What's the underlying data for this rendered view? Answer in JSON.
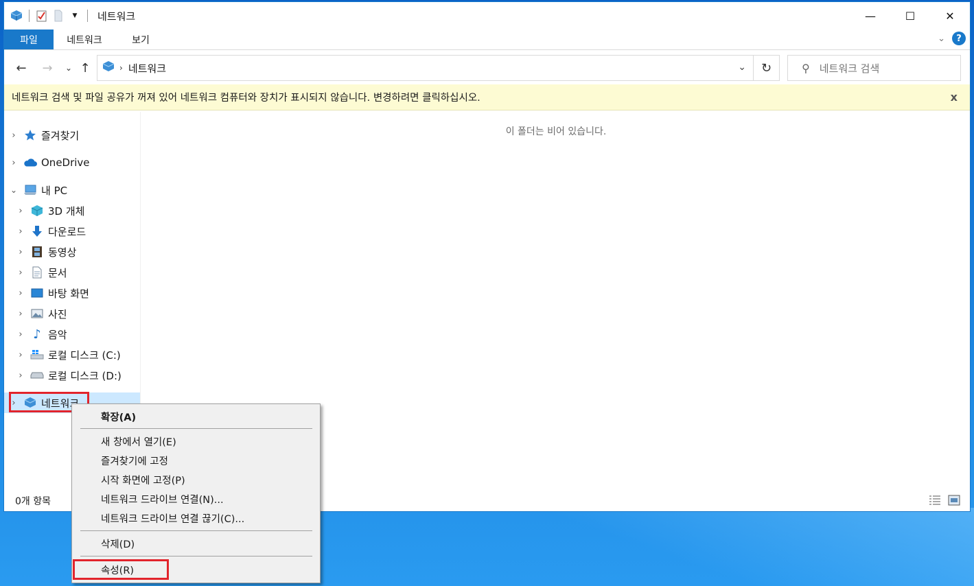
{
  "window": {
    "title": "네트워크",
    "controls": {
      "minimize": "—",
      "maximize": "☐",
      "close": "✕"
    }
  },
  "ribbon": {
    "tabs": [
      "파일",
      "네트워크",
      "보기"
    ],
    "help": "?"
  },
  "address": {
    "breadcrumb": "네트워크",
    "search_placeholder": "네트워크 검색"
  },
  "infobar": {
    "message": "네트워크 검색 및 파일 공유가 꺼져 있어 네트워크 컴퓨터와 장치가 표시되지 않습니다. 변경하려면 클릭하십시오.",
    "close": "x"
  },
  "navpane": {
    "items": [
      {
        "label": "즐겨찾기",
        "icon": "star-icon"
      },
      {
        "label": "OneDrive",
        "icon": "cloud-icon"
      },
      {
        "label": "내 PC",
        "icon": "computer-icon"
      },
      {
        "label": "3D 개체",
        "icon": "cube-icon"
      },
      {
        "label": "다운로드",
        "icon": "download-arrow-icon"
      },
      {
        "label": "동영상",
        "icon": "film-icon"
      },
      {
        "label": "문서",
        "icon": "document-icon"
      },
      {
        "label": "바탕 화면",
        "icon": "desktop-icon"
      },
      {
        "label": "사진",
        "icon": "picture-icon"
      },
      {
        "label": "음악",
        "icon": "music-note-icon"
      },
      {
        "label": "로컬 디스크 (C:)",
        "icon": "windows-drive-icon"
      },
      {
        "label": "로컬 디스크 (D:)",
        "icon": "drive-icon"
      },
      {
        "label": "네트워크",
        "icon": "network-icon"
      }
    ]
  },
  "content": {
    "empty_message": "이 폴더는 비어 있습니다."
  },
  "status": {
    "item_count": "0개 항목"
  },
  "context_menu": {
    "items": [
      "확장(A)",
      "새 창에서 열기(E)",
      "즐겨찾기에 고정",
      "시작 화면에 고정(P)",
      "네트워크 드라이브 연결(N)...",
      "네트워크 드라이브 연결 끊기(C)...",
      "삭제(D)",
      "속성(R)"
    ]
  },
  "colors": {
    "accent": "#1979ca",
    "highlight": "#e2242c",
    "infobar_bg": "#fdfbd3",
    "selection": "#cce8ff"
  }
}
